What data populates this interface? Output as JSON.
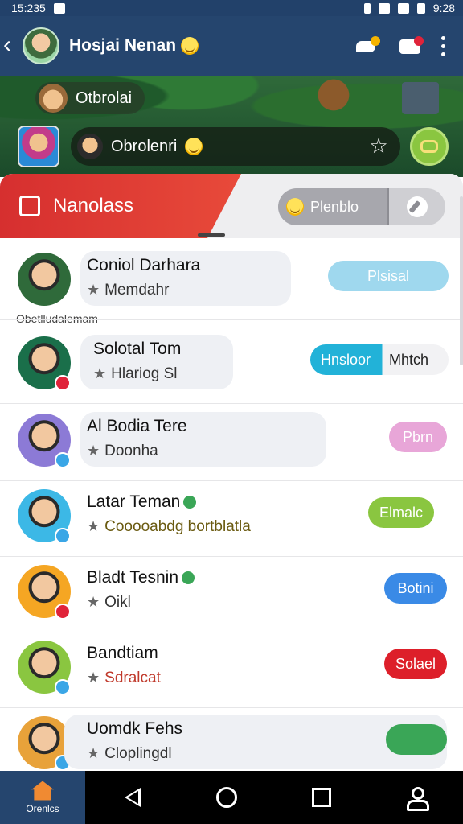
{
  "status_bar": {
    "time_left": "15:235",
    "time_right": "9:28"
  },
  "header": {
    "title": "Hosjai Nenan"
  },
  "banner": {
    "chip_label": "Otbrolai",
    "pill_label": "Obrolenri"
  },
  "section": {
    "title": "Nanolass",
    "segment_label": "Plenblo"
  },
  "divider_label": "Obetlludalemam",
  "contacts": [
    {
      "name": "Coniol Darhara",
      "sub": "Memdahr",
      "action": "Plsisal",
      "action_color": "#9fd8ee"
    },
    {
      "name": "Solotal Tom",
      "sub": "Hlariog Sl",
      "action": "Hnsloor",
      "action_secondary": "Mhtch",
      "action_color": "#22b2d8"
    },
    {
      "name": "Al Bodia Tere",
      "sub": "Doonha",
      "action": "Pbrn",
      "action_color": "#e8a6d8"
    },
    {
      "name": "Latar Teman",
      "sub": "Cooooabdg bortblatla",
      "action": "Elmalc",
      "action_color": "#8ac640"
    },
    {
      "name": "Bladt Tesnin",
      "sub": "Oikl",
      "action": "Botini",
      "action_color": "#3a8ae6"
    },
    {
      "name": "Bandtiam",
      "sub": "Sdralcat",
      "action": "Solael",
      "action_color": "#dd1f2a"
    },
    {
      "name": "Uomdk Fehs",
      "sub": "Cloplingdl",
      "action": "",
      "action_color": "#3aa657"
    }
  ],
  "navbar": {
    "home_label": "Orenlcs"
  }
}
